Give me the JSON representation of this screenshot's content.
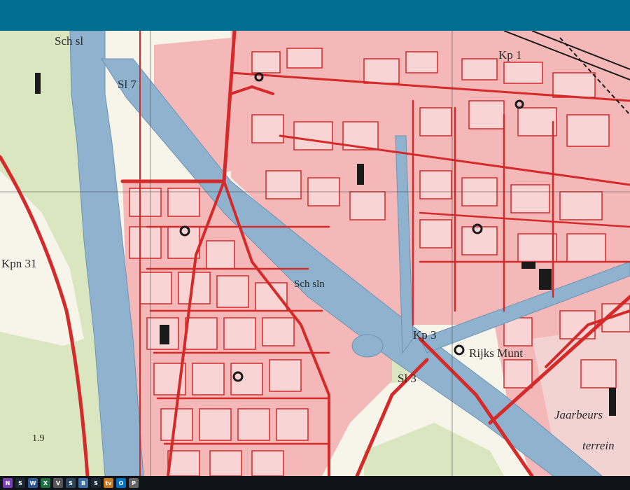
{
  "window": {
    "title_bar_color": "#026f91"
  },
  "map": {
    "colors": {
      "background": "#f7f4ea",
      "green": "#d9e6c0",
      "green_dark": "#9fbf7a",
      "water": "#8fb2cf",
      "water_edge": "#6d93b5",
      "built": "#f5b8b8",
      "road": "#d42a2a",
      "building": "#e0443f",
      "black": "#1a1a1a",
      "grid": "#444444"
    },
    "labels": {
      "sch_sl_top": "Sch sl",
      "sl_top": "Sl 7",
      "kp_top": "Kp 1",
      "kp_31": "Kpn 31",
      "sch_sl_mid": "Sch sln",
      "kp_3": "Kp 3",
      "rijks_munt": "Rijks Munt",
      "sl_3": "Sl 3",
      "jaarbeurs": "Jaarbeurs",
      "terrein": "terrein",
      "elev": "1.9"
    }
  },
  "taskbar": {
    "icons": [
      {
        "name": "onenote-icon",
        "glyph": "N",
        "color": "#7b3fb5"
      },
      {
        "name": "steam-icon",
        "glyph": "S",
        "color": "#1b2838"
      },
      {
        "name": "word-icon",
        "glyph": "W",
        "color": "#2b5797"
      },
      {
        "name": "excel-icon",
        "glyph": "X",
        "color": "#1e7145"
      },
      {
        "name": "vpn-icon",
        "glyph": "V",
        "color": "#555555"
      },
      {
        "name": "steam-icon",
        "glyph": "S",
        "color": "#2a475e"
      },
      {
        "name": "browser-icon",
        "glyph": "B",
        "color": "#3a6ea5"
      },
      {
        "name": "steam-icon",
        "glyph": "S",
        "color": "#1b2838"
      },
      {
        "name": "tv-icon",
        "glyph": "tv",
        "color": "#c8781e"
      },
      {
        "name": "outlook-icon",
        "glyph": "O",
        "color": "#0072c6"
      },
      {
        "name": "paint-icon",
        "glyph": "P",
        "color": "#666666"
      }
    ]
  }
}
